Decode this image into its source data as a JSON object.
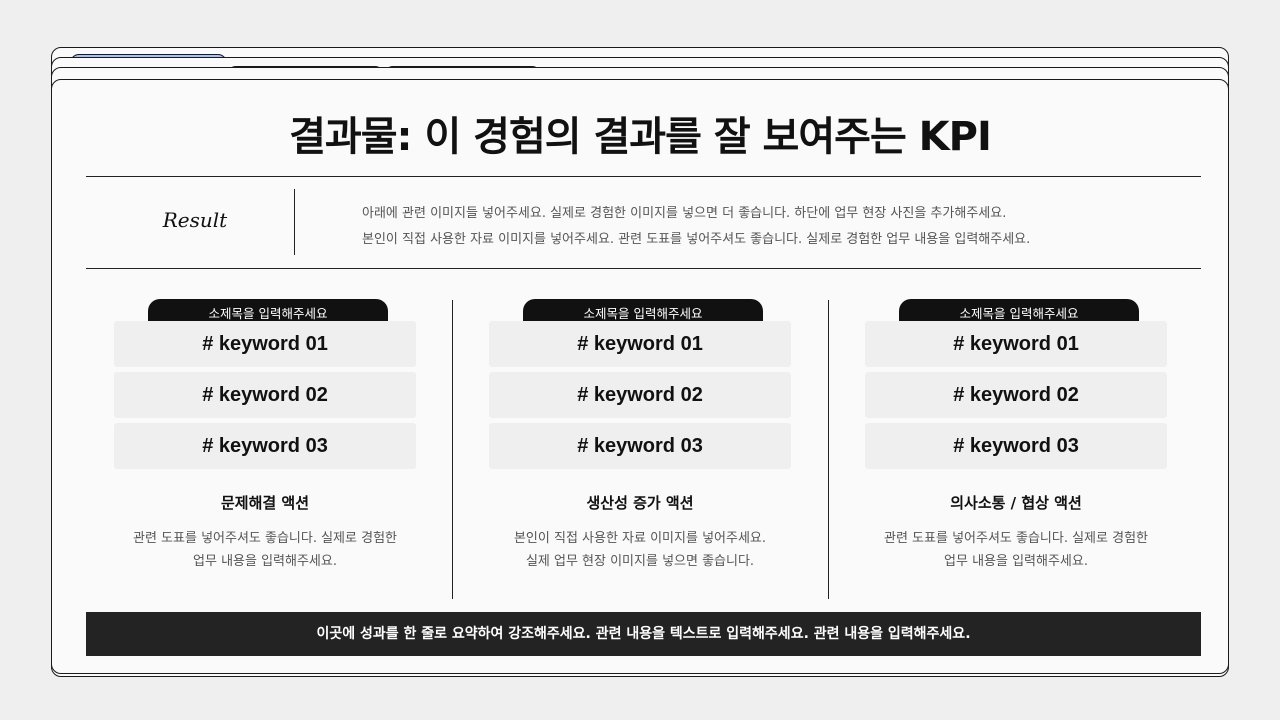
{
  "title": "결과물: 이 경험의 결과를 잘 보여주는 KPI",
  "result": {
    "label": "Result",
    "lines": [
      "아래에 관련 이미지들 넣어주세요. 실제로 경험한 이미지를 넣으면 더 좋습니다. 하단에 업무 현장 사진을 추가해주세요.",
      "본인이 직접 사용한 자료 이미지를 넣어주세요. 관련 도표를 넣어주셔도 좋습니다. 실제로 경험한 업무 내용을 입력해주세요."
    ]
  },
  "columns": [
    {
      "subtitle": "소제목을 입력해주세요",
      "keywords": [
        "# keyword 01",
        "# keyword 02",
        "# keyword 03"
      ],
      "heading": "문제해결 액션",
      "desc": [
        "관련 도표를 넣어주셔도 좋습니다. 실제로 경험한",
        "업무 내용을 입력해주세요."
      ]
    },
    {
      "subtitle": "소제목을 입력해주세요",
      "keywords": [
        "# keyword 01",
        "# keyword 02",
        "# keyword 03"
      ],
      "heading": "생산성 증가 액션",
      "desc": [
        "본인이 직접 사용한 자료 이미지를 넣어주세요.",
        "실제 업무 현장 이미지를 넣으면 좋습니다."
      ]
    },
    {
      "subtitle": "소제목을 입력해주세요",
      "keywords": [
        "# keyword 01",
        "# keyword 02",
        "# keyword 03"
      ],
      "heading": "의사소통 / 협상 액션",
      "desc": [
        "관련 도표를 넣어주셔도 좋습니다. 실제로 경험한",
        "업무 내용을 입력해주세요."
      ]
    }
  ],
  "banner": "이곳에 성과를 한 줄로 요약하여 강조해주세요. 관련 내용을 텍스트로 입력해주세요. 관련 내용을 입력해주세요.",
  "colors": {
    "tab_blue": "#a9c1fb",
    "tab_orange": "#ffc9a3",
    "tab_green": "#c9efa0",
    "banner_bg": "#232323"
  }
}
